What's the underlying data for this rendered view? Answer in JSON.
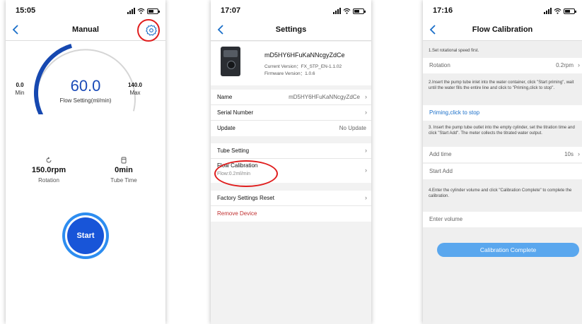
{
  "colors": {
    "accent": "#1855d8",
    "link": "#1a6fc9",
    "highlight_circle": "#e01e1e",
    "danger": "#c03030"
  },
  "panel_manual": {
    "time": "15:05",
    "title": "Manual",
    "settings_icon": "gear-icon",
    "gauge": {
      "value": "60.0",
      "value_number": 60.0,
      "min_value": "0.0",
      "min_label": "Min",
      "max_value": "140.0",
      "max_label": "Max",
      "label": "Flow Setting(ml/min)",
      "fill_fraction": 0.43
    },
    "rotation": {
      "value": "150.0rpm",
      "label": "Rotation",
      "icon": "rotation-icon"
    },
    "tube_time": {
      "value": "0min",
      "label": "Tube Time",
      "icon": "tube-icon"
    },
    "start_label": "Start"
  },
  "panel_settings": {
    "time": "17:07",
    "title": "Settings",
    "device": {
      "name": "mD5HY6HFuKaNNcgyZdCe",
      "current_version": "Current Version：FX_STP_EN-1.1.02",
      "firmware_version": "Firmware Version：1.0.6"
    },
    "rows": {
      "name": {
        "label": "Name",
        "value": "mD5HY6HFuKaNNcgyZdCe"
      },
      "serial": {
        "label": "Serial Number"
      },
      "update": {
        "label": "Update",
        "value": "No Update"
      },
      "tube": {
        "label": "Tube Setting"
      },
      "flow": {
        "label": "Flow Calibration",
        "sub": "Flow:0.2ml/min"
      },
      "factory": {
        "label": "Factory Settings Reset"
      },
      "remove": {
        "label": "Remove Device"
      }
    }
  },
  "panel_calibration": {
    "time": "17:16",
    "title": "Flow Calibration",
    "step1": "1.Set rotational speed first.",
    "rotation": {
      "label": "Rotation",
      "value": "0.2rpm"
    },
    "step2": "2.Insert the pump tube inlet into the water container, click \"Start priming\", wait until the water fills the entire line and click to \"Priming,click to stop\".",
    "priming_label": "Priming,click to stop",
    "step3": "3. Insert the pump tube outlet into the empty cylinder, set the titration time and click \"Start Add\". The meter collects the titrated water output.",
    "add_time": {
      "label": "Add time",
      "value": "10s"
    },
    "start_add_label": "Start Add",
    "step4": "4.Enter the cylinder volume and click \"Calibration Complete\" to complete the calibration.",
    "volume_placeholder": "Enter volume",
    "complete_label": "Calibration Complete"
  }
}
